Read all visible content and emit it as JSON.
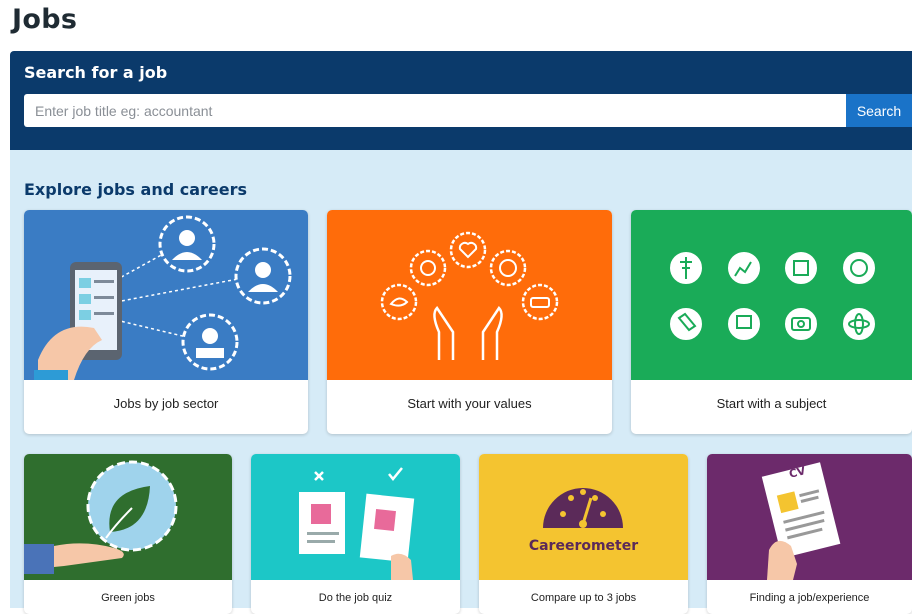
{
  "page": {
    "title": "Jobs"
  },
  "search": {
    "heading": "Search for a job",
    "placeholder": "Enter job title eg: accountant",
    "button_label": "Search"
  },
  "explore": {
    "heading": "Explore jobs and careers",
    "cards_row1": [
      {
        "label": "Jobs by job sector",
        "color": "#3a7cc4"
      },
      {
        "label": "Start with your values",
        "color": "#ff6c0a"
      },
      {
        "label": "Start with a subject",
        "color": "#1aab58"
      }
    ],
    "cards_row2": [
      {
        "label": "Green jobs",
        "color": "#2f6e2e"
      },
      {
        "label": "Do the job quiz",
        "color": "#1cc7c7"
      },
      {
        "label": "Compare up to 3 jobs",
        "color": "#f4c430",
        "image_text": "Careerometer"
      },
      {
        "label": "Finding a job/experience",
        "color": "#6c2a6b",
        "image_text": "CV"
      }
    ]
  }
}
